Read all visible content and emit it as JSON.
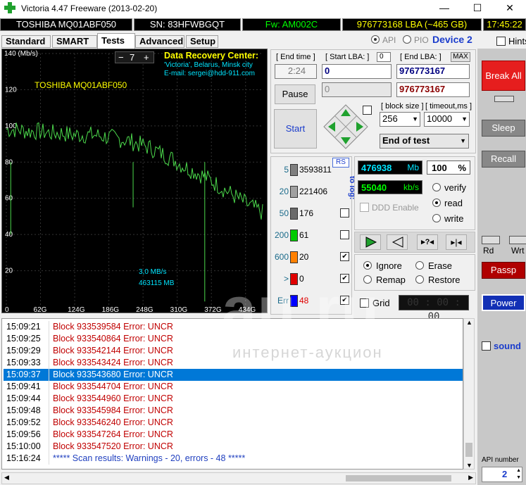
{
  "window": {
    "title": "Victoria 4.47  Freeware (2013-02-20)",
    "minimize": "—",
    "maximize": "☐",
    "close": "✕"
  },
  "infobar": {
    "model": "TOSHIBA MQ01ABF050",
    "serial": "SN: 83HFWBGQT",
    "firmware": "Fw: AM002C",
    "lba": "976773168 LBA (~465 GB)",
    "clock": "17:45:22"
  },
  "tabs": [
    "Standard",
    "SMART",
    "Tests",
    "Advanced",
    "Setup"
  ],
  "api": {
    "api_label": "API",
    "pio_label": "PIO",
    "device_label": "Device 2",
    "hints_label": "Hints"
  },
  "graph": {
    "y_unit": "140 (Mb/s)",
    "y_ticks": [
      "120",
      "100",
      "80",
      "60",
      "40",
      "20"
    ],
    "x_ticks": [
      "0",
      "62G",
      "124G",
      "186G",
      "248G",
      "310G",
      "372G",
      "434G"
    ],
    "drive": "TOSHIBA MQ01ABF050",
    "speed_readout": "3,0 MB/s",
    "mb_readout": "463115 MB",
    "scale_minus": "−",
    "scale_value": "7",
    "scale_plus": "+",
    "promo_title": "Data Recovery Center:",
    "promo_line1": "'Victoria', Belarus, Minsk city",
    "promo_line2": "E-mail: sergei@hdd-911.com"
  },
  "chart_data": {
    "type": "line",
    "title": "",
    "xlabel": "",
    "ylabel": "Mb/s",
    "xlim": [
      0,
      465
    ],
    "ylim": [
      0,
      140
    ],
    "x": [
      0,
      20,
      40,
      60,
      80,
      100,
      120,
      140,
      160,
      180,
      200,
      220,
      240,
      260,
      280,
      300,
      320,
      340,
      360,
      380,
      400,
      420,
      440,
      460,
      465
    ],
    "series": [
      {
        "values": [
          98,
          98,
          97,
          97,
          96,
          96,
          95,
          95,
          95,
          94,
          93,
          92,
          90,
          88,
          85,
          82,
          78,
          75,
          72,
          68,
          64,
          60,
          56,
          53,
          52
        ]
      }
    ]
  },
  "controls": {
    "end_time_label": "[ End time ]",
    "end_time_value": "2:24",
    "start_lba_label": "[ Start LBA: ]",
    "start_lba_small": "0",
    "start_lba_value": "0",
    "end_lba_label": "[ End LBA: ]",
    "end_lba_max": "MAX",
    "end_lba_value": "976773167",
    "cur_lba_value": "0",
    "cur_end_value": "976773167",
    "pause": "Pause",
    "start": "Start",
    "block_size_label": "[ block size ]",
    "block_size_value": "256",
    "timeout_label": "[ timeout,ms ]",
    "timeout_value": "10000",
    "end_action": "End of test"
  },
  "stats": {
    "rs": "RS",
    "to_log": "to log:",
    "rows": [
      {
        "label": "5",
        "count": "3593811",
        "color": "#808080"
      },
      {
        "label": "20",
        "count": "221406",
        "color": "#a0a0a0"
      },
      {
        "label": "50",
        "count": "176",
        "color": "#6a6a6a"
      },
      {
        "label": "200",
        "count": "61",
        "color": "#00cc00"
      },
      {
        "label": "600",
        "count": "20",
        "color": "#ff8000"
      },
      {
        "label": ">",
        "count": "0",
        "color": "#e00000"
      },
      {
        "label": "Err",
        "count": "48",
        "color": "#0000ff"
      }
    ]
  },
  "progress": {
    "mb_value": "476938",
    "mb_unit": "Mb",
    "percent_value": "100",
    "percent_unit": "%",
    "speed_value": "55040",
    "speed_unit": "kb/s",
    "verify": "verify",
    "read": "read",
    "write": "write",
    "ddd": "DDD Enable"
  },
  "actions": {
    "ignore": "Ignore",
    "erase": "Erase",
    "remap": "Remap",
    "restore": "Restore",
    "grid": "Grid",
    "timer": "00 : 00 : 00"
  },
  "side": {
    "break_all": "Break All",
    "sleep": "Sleep",
    "recall": "Recall",
    "rd": "Rd",
    "wrt": "Wrt",
    "passp": "Passp",
    "power": "Power",
    "sound": "sound",
    "api_number_label": "API number",
    "api_number": "2"
  },
  "log": [
    {
      "time": "15:09:21",
      "msg": "Block 933539584 Error: UNCR"
    },
    {
      "time": "15:09:25",
      "msg": "Block 933540864 Error: UNCR"
    },
    {
      "time": "15:09:29",
      "msg": "Block 933542144 Error: UNCR"
    },
    {
      "time": "15:09:33",
      "msg": "Block 933543424 Error: UNCR"
    },
    {
      "time": "15:09:37",
      "msg": "Block 933543680 Error: UNCR"
    },
    {
      "time": "15:09:41",
      "msg": "Block 933544704 Error: UNCR"
    },
    {
      "time": "15:09:44",
      "msg": "Block 933544960 Error: UNCR"
    },
    {
      "time": "15:09:48",
      "msg": "Block 933545984 Error: UNCR"
    },
    {
      "time": "15:09:52",
      "msg": "Block 933546240 Error: UNCR"
    },
    {
      "time": "15:09:56",
      "msg": "Block 933547264 Error: UNCR"
    },
    {
      "time": "15:10:00",
      "msg": "Block 933547520 Error: UNCR"
    },
    {
      "time": "15:16:24",
      "msg": "***** Scan results: Warnings - 20, errors - 48 *****"
    }
  ],
  "watermark": {
    "main": "au.ru",
    "sub": "интернет-аукцион"
  }
}
